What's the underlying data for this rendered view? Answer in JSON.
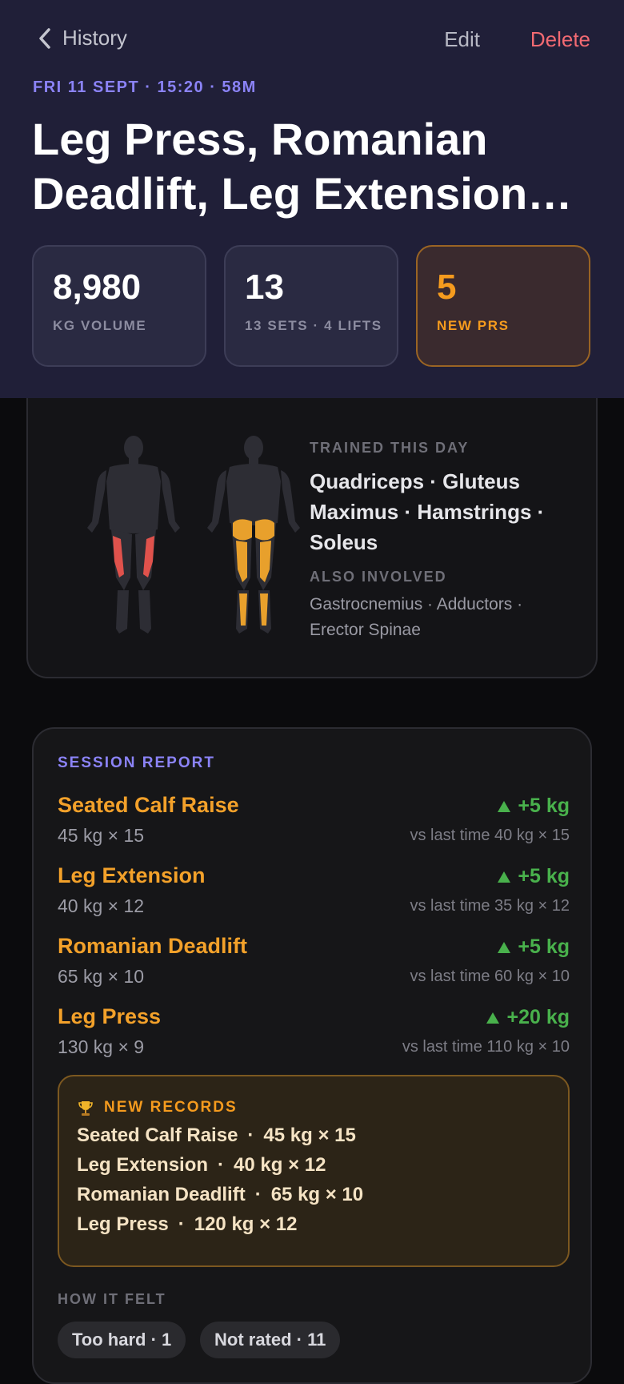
{
  "nav": {
    "back_label": "History",
    "edit_label": "Edit",
    "delete_label": "Delete"
  },
  "session": {
    "meta": "FRI 11 SEPT · 15:20 · 58M",
    "title": "Leg Press, Romanian Deadlift, Leg Extension…"
  },
  "stats": [
    {
      "value": "8,980",
      "label": "KG VOLUME"
    },
    {
      "value": "13",
      "label": "13 SETS · 4 LIFTS"
    },
    {
      "value": "5",
      "label": "NEW PRS"
    }
  ],
  "muscles": {
    "trained_caption": "TRAINED THIS DAY",
    "trained": "Quadriceps · Gluteus Maximus · Hamstrings · Soleus",
    "involved_caption": "ALSO INVOLVED",
    "involved": "Gastrocnemius · Adductors · Erector Spinae"
  },
  "report": {
    "heading": "SESSION REPORT",
    "exercises": [
      {
        "name": "Seated Calf Raise",
        "set": "45 kg × 15",
        "delta": "+5 kg",
        "previous": "vs last time 40 kg × 15"
      },
      {
        "name": "Leg Extension",
        "set": "40 kg × 12",
        "delta": "+5 kg",
        "previous": "vs last time 35 kg × 12"
      },
      {
        "name": "Romanian Deadlift",
        "set": "65 kg × 10",
        "delta": "+5 kg",
        "previous": "vs last time 60 kg × 10"
      },
      {
        "name": "Leg Press",
        "set": "130 kg × 9",
        "delta": "+20 kg",
        "previous": "vs last time 110 kg × 10"
      }
    ],
    "records_title": "NEW RECORDS",
    "records": [
      {
        "name": "Seated Calf Raise",
        "value": "45 kg × 15"
      },
      {
        "name": "Leg Extension",
        "value": "40 kg × 12"
      },
      {
        "name": "Romanian Deadlift",
        "value": "65 kg × 10"
      },
      {
        "name": "Leg Press",
        "value": "120 kg × 12"
      }
    ],
    "felt_caption": "HOW IT FELT",
    "felt_chips": [
      "Too hard · 1",
      "Not rated · 11"
    ]
  },
  "colors": {
    "accent": "#8b83f7",
    "pr": "#f59b1e",
    "delete": "#f26a72",
    "gain": "#49b14c",
    "trained_front": "#e0524c",
    "trained_back": "#e8a02c"
  }
}
